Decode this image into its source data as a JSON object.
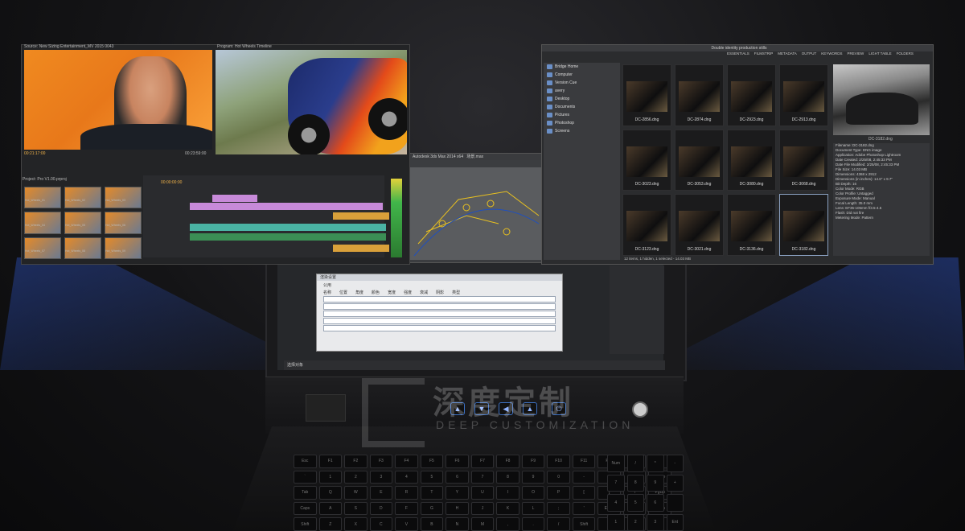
{
  "watermark": {
    "cn": "深度定制",
    "en": "DEEP CUSTOMIZATION"
  },
  "premiere": {
    "source_title": "Source: New Sizing Entertainment_MV 2015 0043",
    "program_title": "Program: Hot Wheels Timeline",
    "tc_left": "00:21:17:00",
    "tc_right": "00:23:59:00",
    "timeline_tc": "00:00:00:00",
    "project_label": "Project: Pro V1.00.prproj",
    "clips": [
      "Hot_Wheels_01",
      "Hot_Wheels_02",
      "Hot_Wheels_03",
      "Hot_Wheels_04",
      "Hot_Wheels_05",
      "Hot_Wheels_06",
      "Hot_Wheels_07",
      "Hot_Wheels_08",
      "Hot_Wheels_09"
    ]
  },
  "max": {
    "title": "Autodesk 3ds Max 2014 x64",
    "file": "场景.max"
  },
  "bridge": {
    "title": "Double identity production stills",
    "workspace_tabs": [
      "ESSENTIALS",
      "FILMSTRIP",
      "METADATA",
      "OUTPUT",
      "KEYWORDS",
      "PREVIEW",
      "LIGHT TABLE",
      "FOLDERS"
    ],
    "sidebar": [
      "Bridge Home",
      "Computer",
      "Version Cue",
      "avery",
      "Desktop",
      "Documents",
      "Pictures",
      "Photoshop",
      "Screens"
    ],
    "thumbs": [
      "DC-2856.dng",
      "DC-2874.dng",
      "DC-2923.dng",
      "DC-2913.dng",
      "DC-3023.dng",
      "DC-3053.dng",
      "DC-3080.dng",
      "DC-3068.dng",
      "DC-3123.dng",
      "DC-3021.dng",
      "DC-3136.dng",
      "DC-3182.dng"
    ],
    "preview_caption": "DC-3182.dng",
    "metadata": [
      "Filename: DC-3182.dng",
      "Document Type: DNG image",
      "Application: Adobe Photoshop Lightroom",
      "Date Created: 2/25/08, 2:45:33 PM",
      "Date File Modified: 2/25/08, 2:45:33 PM",
      "File Size: 14.03 MB",
      "Dimensions: 4368 x 2912",
      "Dimensions (in inches): 14.6\" x 9.7\"",
      "Bit Depth: 16",
      "Color Mode: RGB",
      "Color Profile: Untagged",
      "Exposure Mode: Manual",
      "Focal Length: 35.0 mm",
      "Lens: EF35-105mm f/3.5-4.5",
      "Flash: Did not fire",
      "Metering Mode: Pattern"
    ],
    "status": "12 items, 1 hidden, 1 selected - 14.03 MB"
  },
  "dialog": {
    "title": "渲染设置",
    "tab": "公用",
    "columns": [
      "名称",
      "位置",
      "角度",
      "颜色",
      "宽度",
      "强度",
      "衰减",
      "阴影",
      "类型"
    ]
  },
  "bottombar": {
    "label": "选择对象"
  },
  "controls": [
    "▲",
    "▼",
    "◀",
    "▲",
    "⏻"
  ],
  "keyboard": [
    "Esc",
    "F1",
    "F2",
    "F3",
    "F4",
    "F5",
    "F6",
    "F7",
    "F8",
    "F9",
    "F10",
    "F11",
    "F12",
    "Prt",
    "Del",
    "`",
    "1",
    "2",
    "3",
    "4",
    "5",
    "6",
    "7",
    "8",
    "9",
    "0",
    "-",
    "=",
    "Bksp",
    "Home",
    "Tab",
    "Q",
    "W",
    "E",
    "R",
    "T",
    "Y",
    "U",
    "I",
    "O",
    "P",
    "[",
    "]",
    "\\",
    "PgUp",
    "Caps",
    "A",
    "S",
    "D",
    "F",
    "G",
    "H",
    "J",
    "K",
    "L",
    ";",
    "'",
    "Enter",
    "",
    "PgDn",
    "Shift",
    "Z",
    "X",
    "C",
    "V",
    "B",
    "N",
    "M",
    ",",
    ".",
    "/",
    "Shift",
    "↑",
    "",
    "End"
  ],
  "numpad": [
    "Num",
    "/",
    "*",
    "-",
    "7",
    "8",
    "9",
    "+",
    "4",
    "5",
    "6",
    "",
    "1",
    "2",
    "3",
    "Ent"
  ]
}
